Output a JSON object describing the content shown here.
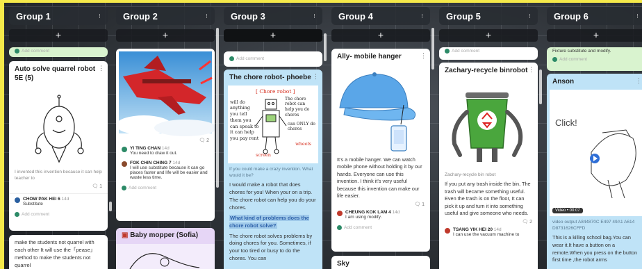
{
  "add_symbol": "+",
  "columns": [
    {
      "title": "Group 1"
    },
    {
      "title": "Group 2"
    },
    {
      "title": "Group 3"
    },
    {
      "title": "Group 4"
    },
    {
      "title": "Group 5"
    },
    {
      "title": "Group 6"
    }
  ],
  "header_option": "⁝",
  "add_comment": "Add comment",
  "g1": {
    "card_title": "Auto solve quarrel robot 5E (5)",
    "desc": "I invented this invention because it can help teacher to",
    "comment_count": "1",
    "comment_author": "CHOW PAK HEI 6",
    "comment_time": "14d",
    "comment_text": "Substitute",
    "card2_text": "make the students not quarrel with each other It will use the「pease」method to make the students not quarrel"
  },
  "g2": {
    "comment_count": "2",
    "c1_author": "YI TING CHAN",
    "c1_time": "14d",
    "c1_text": "You need to draw it out.",
    "c2_author": "FOK CHIN CHING 7",
    "c2_time": "14d",
    "c2_text": "I will use substitute because it can go places faster and life will be easier and waste less time.",
    "card2_title": "Baby mopper (Sofia)"
  },
  "g3": {
    "card_title": "The chore robot- phoebe",
    "prompt": "If you could make a crazy invention. What would it be?",
    "answer": "I would make a robot that does chores for you! When your on a trip. The chore robot can help you do your chores.",
    "question": "What kind of problems does the chore robot solve?",
    "answer2": "The chore robot solves problems by doing chores for you. Sometimes, if your too tired or busy to do the chores. You can",
    "drawing_title": "Chore robot",
    "drawing_text_left": "will do anything you tell them you can speak to it can help you pay rent",
    "drawing_text_right": "The chore robot can help you do chores",
    "drawing_text_only": "can ONLY do chores",
    "drawing_wheels": "wheels",
    "drawing_screen": "screen"
  },
  "g4": {
    "card_title": "Ally- mobile hanger",
    "desc": "It's a mobile hanger. We can watch mobile phone without holding it by our hands. Everyone can use this invention. I think it's very useful because this invention can make our life easier.",
    "comment_count": "1",
    "comment_author": "CHEUNG KOK LAM 4",
    "comment_time": "14d",
    "comment_text": "I am using modify.",
    "card2_title": "Sky"
  },
  "g5": {
    "card_title": "Zachary-recycle binrobot",
    "caption": "Zachary-recycle bin robot",
    "desc": "If you put any trash inside the bin, The trash will became something useful. Even the trash is on the floor, It can pick it up and turn it into something useful and give someone who needs.",
    "comment_count": "2",
    "comment_author": "TSANG YIK HEI 20",
    "comment_time": "14d",
    "comment_text": "I can use the vacuum machine to"
  },
  "g6": {
    "top_text": "Fixture substitute and modify.",
    "card_title": "Anson",
    "click_text": "Click!",
    "video_label": "Video • 00:07",
    "video_output": "video output A844870C E497 49A1 A614 D8731626CFFD",
    "desc": "This is a killing school bag.You can wear it.It have a button on a remote.When you press on the button first time ,the robot arms"
  }
}
